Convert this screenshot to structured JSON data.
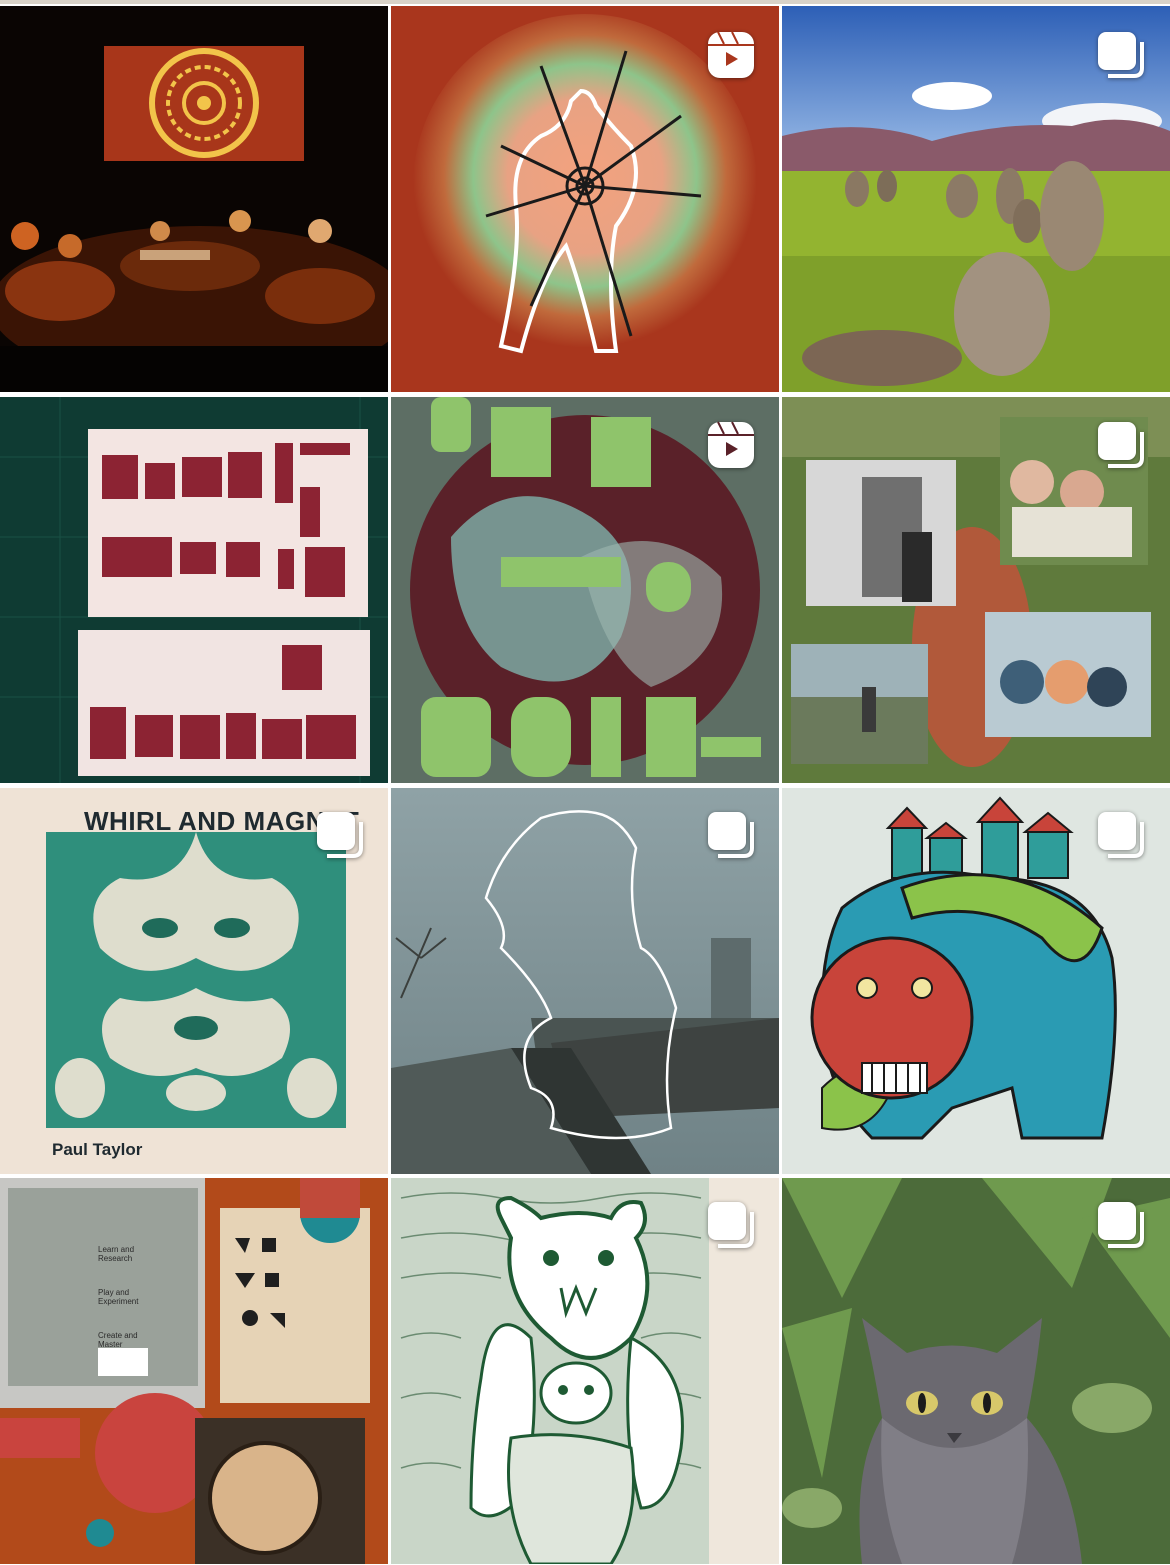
{
  "grid": {
    "posts": [
      {
        "id": "post-1",
        "badge": "none",
        "icon": "concert-photo"
      },
      {
        "id": "post-2",
        "badge": "reel",
        "icon": "reels-icon"
      },
      {
        "id": "post-3",
        "badge": "carousel",
        "icon": "carousel-icon"
      },
      {
        "id": "post-4",
        "badge": "none",
        "icon": "bonjour-letters"
      },
      {
        "id": "post-5",
        "badge": "reel",
        "icon": "reels-icon"
      },
      {
        "id": "post-6",
        "badge": "carousel",
        "icon": "carousel-icon"
      },
      {
        "id": "post-7",
        "badge": "carousel",
        "icon": "carousel-icon"
      },
      {
        "id": "post-8",
        "badge": "carousel",
        "icon": "carousel-icon"
      },
      {
        "id": "post-9",
        "badge": "carousel",
        "icon": "carousel-icon"
      },
      {
        "id": "post-10",
        "badge": "none",
        "icon": "workshop-collage"
      },
      {
        "id": "post-11",
        "badge": "carousel",
        "icon": "carousel-icon"
      },
      {
        "id": "post-12",
        "badge": "carousel",
        "icon": "carousel-icon"
      }
    ]
  },
  "album": {
    "title": "WHIRL AND MAGNET",
    "artist": "Paul Taylor"
  },
  "workshop": {
    "step1": "Learn and Research",
    "step2": "Play and Experiment",
    "step3": "Create and Master"
  },
  "colors": {
    "rust": "#a9361d",
    "green": "#7dbd6a",
    "teal": "#2f8f7c",
    "cream": "#efe2d4",
    "badge": "#ffffff"
  }
}
